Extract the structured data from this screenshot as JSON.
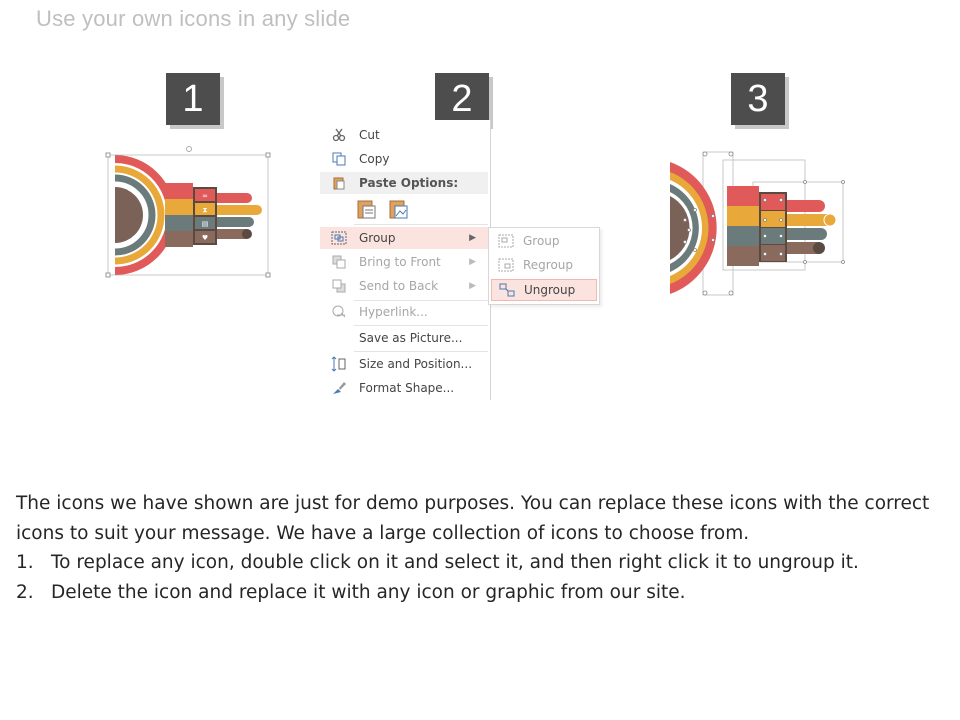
{
  "slide": {
    "title": "Use your own icons in any slide"
  },
  "steps": [
    "1",
    "2",
    "3"
  ],
  "colors": {
    "red": "#e05a5a",
    "yellow": "#e8a93a",
    "slate": "#6b7b7b",
    "brown": "#8a6a5c",
    "badge": "#4d4d4d",
    "menu_highlight": "#fbe3e0"
  },
  "context_menu": {
    "items": [
      {
        "label": "Cut",
        "icon": "scissors-icon"
      },
      {
        "label": "Copy",
        "icon": "copy-icon"
      },
      {
        "label": "Paste Options:",
        "icon": "paste-icon"
      },
      {
        "label": "Group",
        "icon": "group-icon"
      },
      {
        "label": "Bring to Front",
        "icon": "bring-to-front-icon"
      },
      {
        "label": "Send to Back",
        "icon": "send-to-back-icon"
      },
      {
        "label": "Hyperlink...",
        "icon": "hyperlink-icon"
      },
      {
        "label": "Save as Picture...",
        "icon": ""
      },
      {
        "label": "Size and Position...",
        "icon": "size-position-icon"
      },
      {
        "label": "Format Shape...",
        "icon": "format-shape-icon"
      }
    ],
    "paste_option_icons": [
      "paste-keep-formatting-icon",
      "paste-picture-icon"
    ]
  },
  "group_submenu": {
    "items": [
      {
        "label": "Group",
        "icon": "group-icon"
      },
      {
        "label": "Regroup",
        "icon": "regroup-icon"
      },
      {
        "label": "Ungroup",
        "icon": "ungroup-icon"
      }
    ]
  },
  "instructions": {
    "intro": "The icons we have shown are just for demo purposes. You can replace these icons with the correct icons to suit your message. We have a large collection of icons to choose from.",
    "steps": [
      {
        "num": "1.",
        "text": "To replace any icon, double click on it and select it, and then right click it to ungroup it."
      },
      {
        "num": "2.",
        "text": "Delete the icon and replace it with any icon or graphic from our site."
      }
    ]
  }
}
